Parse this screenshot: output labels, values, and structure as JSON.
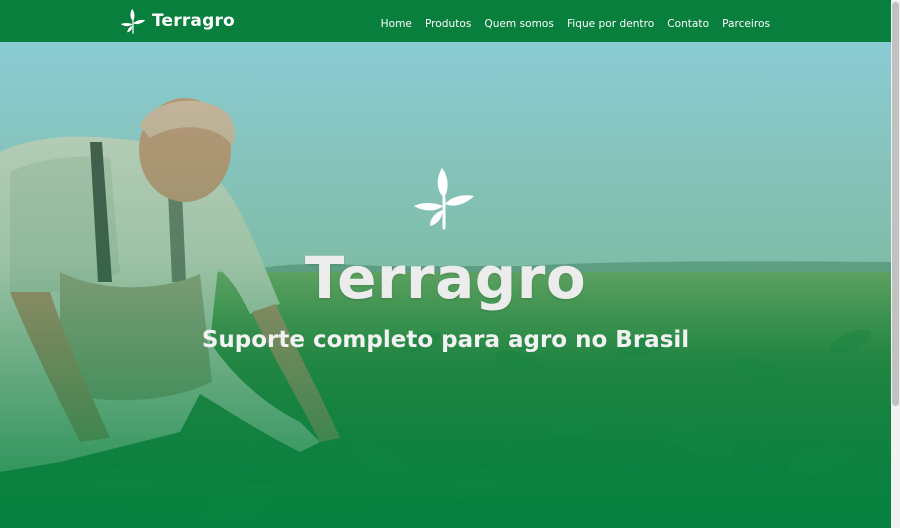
{
  "brand": {
    "name": "Terragro",
    "logo_icon": "sprout-icon"
  },
  "nav": {
    "links": [
      "Home",
      "Produtos",
      "Quem somos",
      "Fique por dentro",
      "Contato",
      "Parceiros"
    ]
  },
  "hero": {
    "logo_icon": "sprout-icon",
    "title": "Terragro",
    "subtitle": "Suporte completo para agro no Brasil",
    "image": "farmer-in-soybean-field"
  },
  "colors": {
    "brand_green": "#087f3d",
    "title_text": "#ececec"
  },
  "scrollbar": {
    "position": 0.0
  }
}
